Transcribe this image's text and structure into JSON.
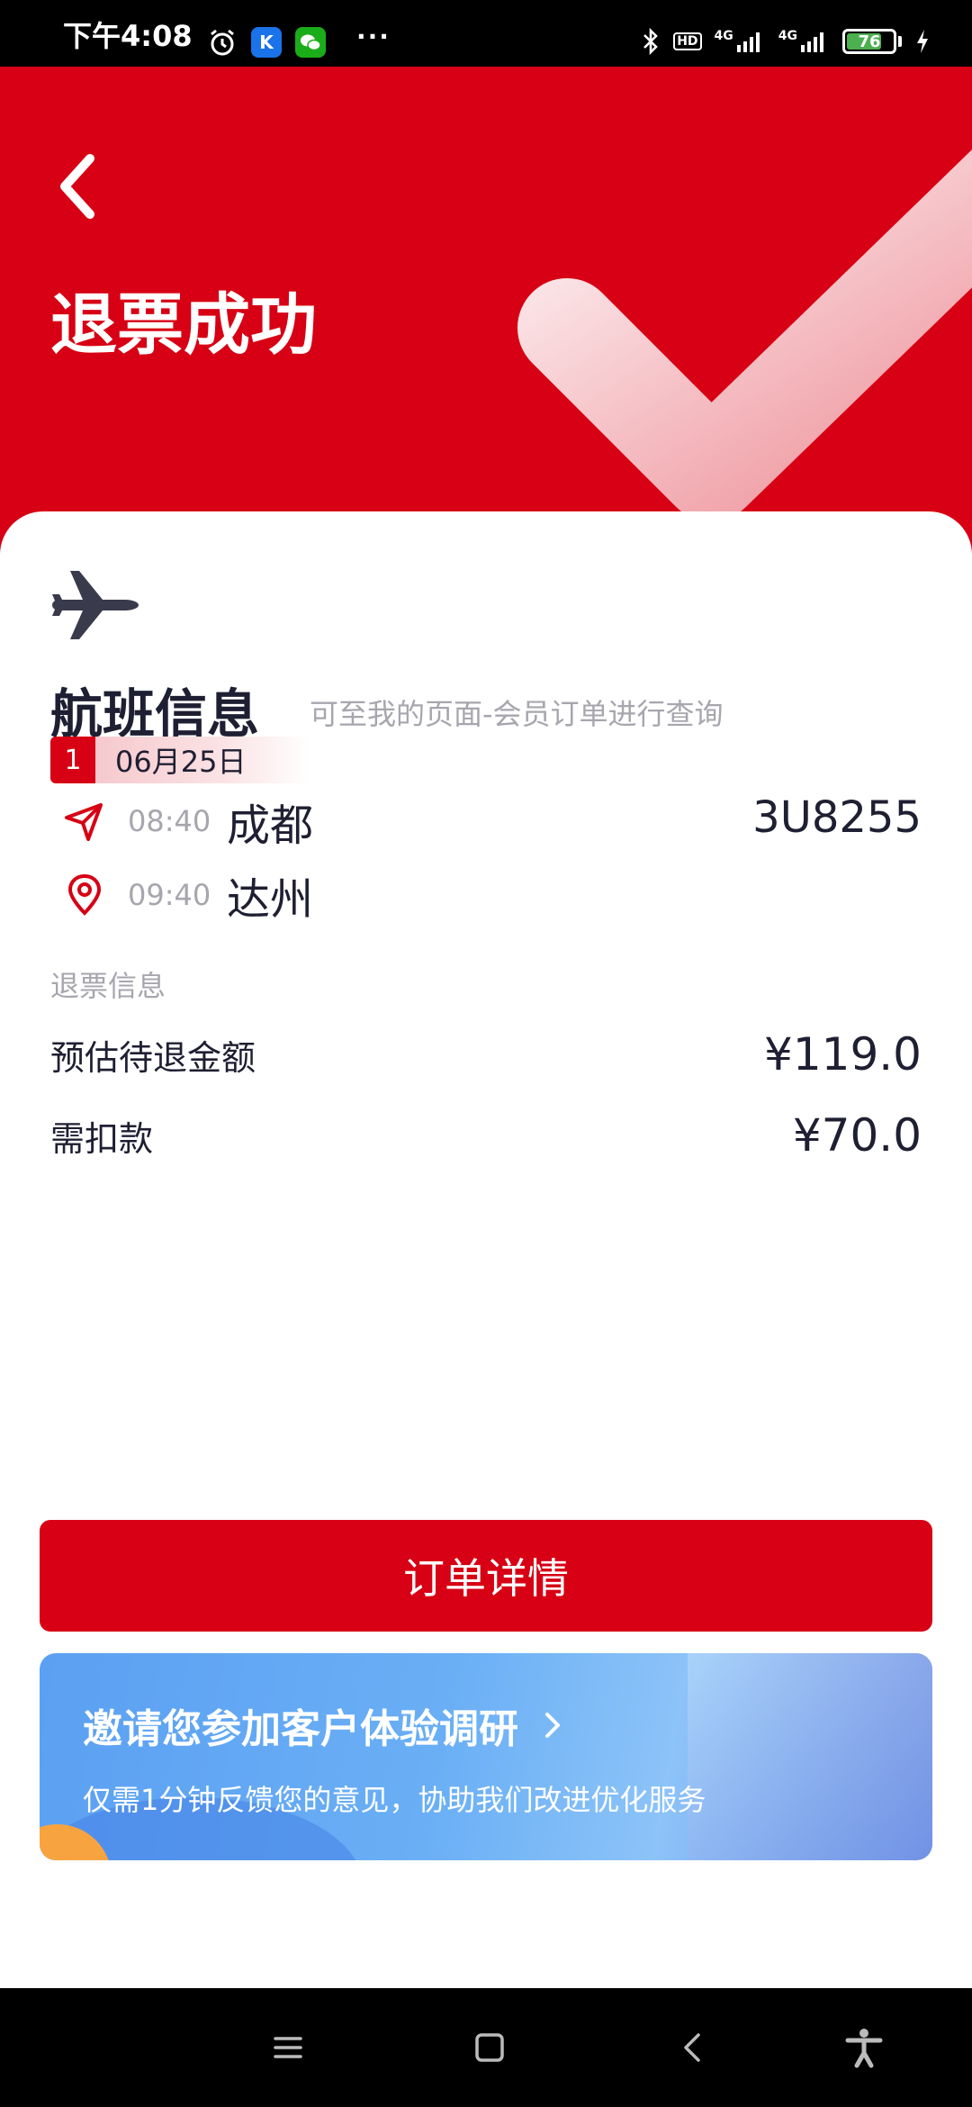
{
  "status_bar": {
    "time": "下午4:08",
    "battery": "76",
    "network_1": "4G",
    "network_2": "4G",
    "hd": "HD",
    "app_k_label": "K",
    "more": "···"
  },
  "header": {
    "title": "退票成功"
  },
  "flight": {
    "section_title": "航班信息",
    "hint": "可至我的页面-会员订单进行查询",
    "segment_index": "1",
    "date": "06月25日",
    "departure_time": "08:40",
    "departure_city": "成都",
    "arrival_time": "09:40",
    "arrival_city": "达州",
    "flight_number": "3U8255"
  },
  "refund": {
    "section_label": "退票信息",
    "estimated_label": "预估待退金额",
    "estimated_value": "¥119.0",
    "deduction_label": "需扣款",
    "deduction_value": "¥70.0"
  },
  "actions": {
    "order_details": "订单详情"
  },
  "survey": {
    "title": "邀请您参加客户体验调研",
    "subtitle": "仅需1分钟反馈您的意见，协助我们改进优化服务"
  },
  "colors": {
    "brand_red": "#d70014",
    "text_dark": "#1f1f33",
    "text_muted": "#a6a6ae"
  }
}
